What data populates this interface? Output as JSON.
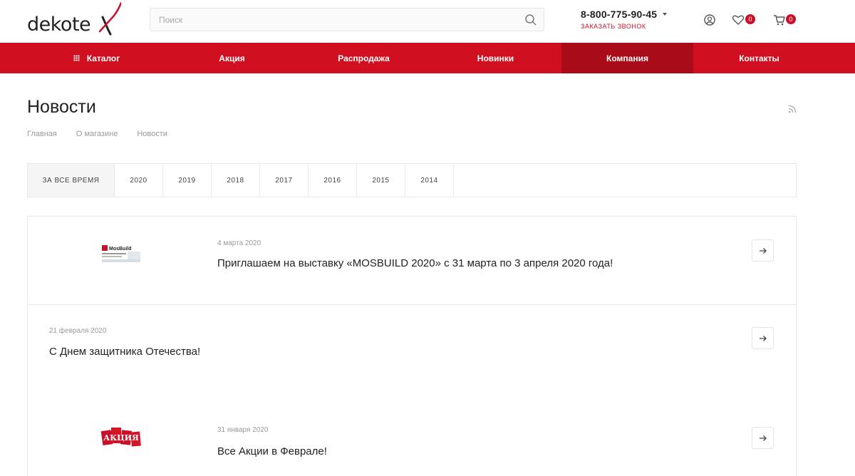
{
  "header": {
    "logo_text": "dekote",
    "search_placeholder": "Поиск",
    "phone": "8-800-775-90-45",
    "callback": "Заказать звонок",
    "favorites_count": "0",
    "cart_count": "0"
  },
  "nav": {
    "items": [
      {
        "label": "Каталог"
      },
      {
        "label": "Акция"
      },
      {
        "label": "Распродажа"
      },
      {
        "label": "Новинки"
      },
      {
        "label": "Компания"
      },
      {
        "label": "Контакты"
      }
    ],
    "active": "Компания",
    "bg_color": "#d01020",
    "active_color": "#a90b19"
  },
  "page": {
    "title": "Новости",
    "breadcrumb": [
      "Главная",
      "О магазине",
      "Новости"
    ]
  },
  "tabs": {
    "items": [
      {
        "label": "За все время"
      },
      {
        "label": "2020"
      },
      {
        "label": "2019"
      },
      {
        "label": "2018"
      },
      {
        "label": "2017"
      },
      {
        "label": "2016"
      },
      {
        "label": "2015"
      },
      {
        "label": "2014"
      }
    ]
  },
  "news": [
    {
      "date": "4 марта 2020",
      "title": "Приглашаем на выставку «MOSBUILD 2020» с 31 марта по 3 апреля 2020 года!",
      "image": "mosbuild-logo",
      "image_text": "MosBuild"
    },
    {
      "date": "21 февраля 2020",
      "title": "С Днем защитника Отечества!"
    },
    {
      "date": "31 января 2020",
      "title": "Все Акции в Феврале!",
      "image": "akciya-tags",
      "image_text": "АКЦИЯ"
    }
  ]
}
